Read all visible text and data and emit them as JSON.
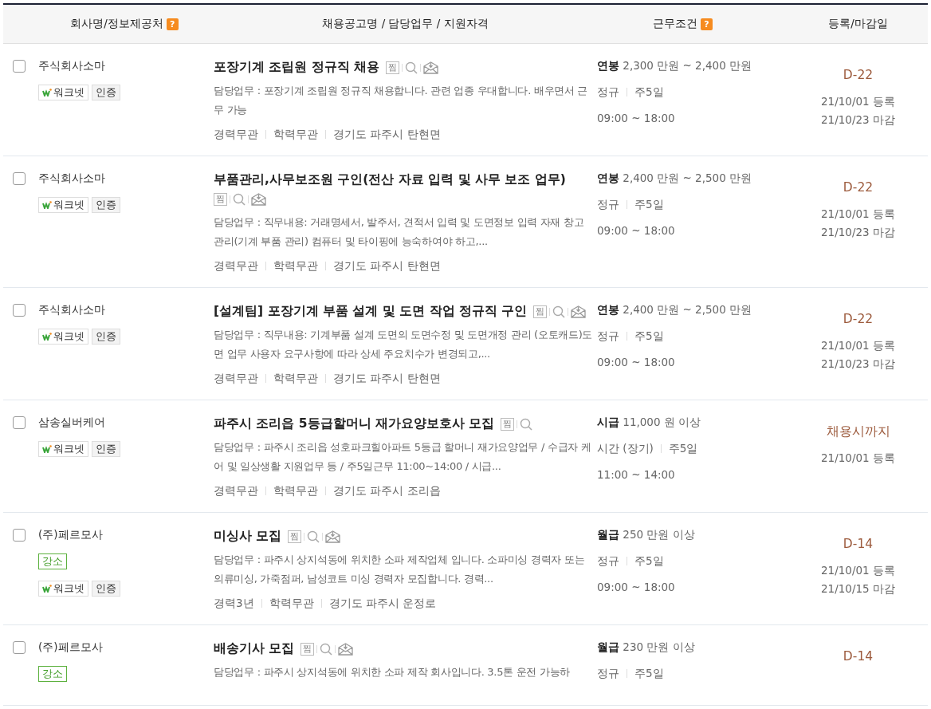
{
  "header": {
    "columns": [
      {
        "label": "회사명/정보제공처",
        "help": "?"
      },
      {
        "label": "채용공고명 / 담당업무 / 지원자격"
      },
      {
        "label": "근무조건",
        "help": "?"
      },
      {
        "label": "등록/마감일"
      }
    ]
  },
  "rows": [
    {
      "selected": false,
      "company": "주식회사소마",
      "badges": [
        {
          "kind": "worknet",
          "label": "워크넷"
        },
        {
          "kind": "cert",
          "label": "인증"
        }
      ],
      "title": "포장기계 조립원 정규직 채용",
      "scrap": "찜",
      "online_apply": true,
      "duty": "담당업무 : 포장기계 조립원 정규직 채용합니다. 관련 업종 우대합니다. 배우면서 근무 가능",
      "quals": [
        "경력무관",
        "학력무관",
        "경기도 파주시 탄현면"
      ],
      "pay_type": "연봉",
      "pay": "2,300 만원 ~ 2,400 만원",
      "terms": [
        "정규",
        "주5일"
      ],
      "hours": "09:00 ~ 18:00",
      "deadline": "D-22",
      "dates": [
        "21/10/01 등록",
        "21/10/23 마감"
      ]
    },
    {
      "selected": false,
      "company": "주식회사소마",
      "badges": [
        {
          "kind": "worknet",
          "label": "워크넷"
        },
        {
          "kind": "cert",
          "label": "인증"
        }
      ],
      "title": "부품관리,사무보조원 구인(전산 자료 입력 및 사무 보조 업무)",
      "scrap": "찜",
      "online_apply": true,
      "duty": "담당업무 : 직무내용: 거래명세서, 발주서, 견적서 입력 및 도면정보 입력 자재 창고 관리(기계 부품 관리) 컴퓨터 및 타이핑에 능숙하여야 하고,...",
      "quals": [
        "경력무관",
        "학력무관",
        "경기도 파주시 탄현면"
      ],
      "pay_type": "연봉",
      "pay": "2,400 만원 ~ 2,500 만원",
      "terms": [
        "정규",
        "주5일"
      ],
      "hours": "09:00 ~ 18:00",
      "deadline": "D-22",
      "dates": [
        "21/10/01 등록",
        "21/10/23 마감"
      ]
    },
    {
      "selected": false,
      "company": "주식회사소마",
      "badges": [
        {
          "kind": "worknet",
          "label": "워크넷"
        },
        {
          "kind": "cert",
          "label": "인증"
        }
      ],
      "title": "[설계팀] 포장기계 부품 설계 및 도면 작업 정규직 구인",
      "scrap": "찜",
      "online_apply": true,
      "duty": "담당업무 : 직무내용: 기계부품 설계 도면의 도면수정 및 도면개정 관리 (오토캐드)도면 업무 사용자 요구사항에 따라 상세 주요치수가 변경되고,...",
      "quals": [
        "경력무관",
        "학력무관",
        "경기도 파주시 탄현면"
      ],
      "pay_type": "연봉",
      "pay": "2,400 만원 ~ 2,500 만원",
      "terms": [
        "정규",
        "주5일"
      ],
      "hours": "09:00 ~ 18:00",
      "deadline": "D-22",
      "dates": [
        "21/10/01 등록",
        "21/10/23 마감"
      ]
    },
    {
      "selected": false,
      "company": "삼송실버케어",
      "badges": [
        {
          "kind": "worknet",
          "label": "워크넷"
        },
        {
          "kind": "cert",
          "label": "인증"
        }
      ],
      "title": "파주시 조리읍 5등급할머니 재가요양보호사 모집",
      "scrap": "찜",
      "online_apply": false,
      "duty": "담당업무 : 파주시 조리읍 성호파크힐아파트 5등급 할머니 재가요양업무 / 수급자 케어 및 일상생활 지원업무 등 / 주5일근무 11:00~14:00 / 시급...",
      "quals": [
        "경력무관",
        "학력무관",
        "경기도 파주시 조리읍"
      ],
      "pay_type": "시급",
      "pay": "11,000 원 이상",
      "terms": [
        "시간 (장기)",
        "주5일"
      ],
      "hours": "11:00 ~ 14:00",
      "deadline": "채용시까지",
      "dates": [
        "21/10/01 등록"
      ]
    },
    {
      "selected": false,
      "company": "(주)페르모사",
      "tag": "강소",
      "badges": [
        {
          "kind": "worknet",
          "label": "워크넷"
        },
        {
          "kind": "cert",
          "label": "인증"
        }
      ],
      "title": "미싱사 모집",
      "scrap": "찜",
      "online_apply": true,
      "duty": "담당업무 : 파주시 상지석동에 위치한 소파 제작업체 입니다. 소파미싱 경력자 또는 의류미싱, 가죽점퍼, 남성코트 미싱 경력자 모집합니다. 경력...",
      "quals": [
        "경력3년",
        "학력무관",
        "경기도 파주시 운정로"
      ],
      "pay_type": "월급",
      "pay": "250 만원 이상",
      "terms": [
        "정규",
        "주5일"
      ],
      "hours": "09:00 ~ 18:00",
      "deadline": "D-14",
      "dates": [
        "21/10/01 등록",
        "21/10/15 마감"
      ]
    },
    {
      "selected": false,
      "company": "(주)페르모사",
      "tag": "강소",
      "title": "배송기사 모집",
      "scrap": "찜",
      "online_apply": true,
      "duty": "담당업무 : 파주시 상지석동에 위치한 소파 제작 회사입니다. 3.5톤 운전 가능하",
      "pay_type": "월급",
      "pay": "230 만원 이상",
      "terms": [
        "정규",
        "주5일"
      ],
      "deadline": "D-14"
    }
  ]
}
